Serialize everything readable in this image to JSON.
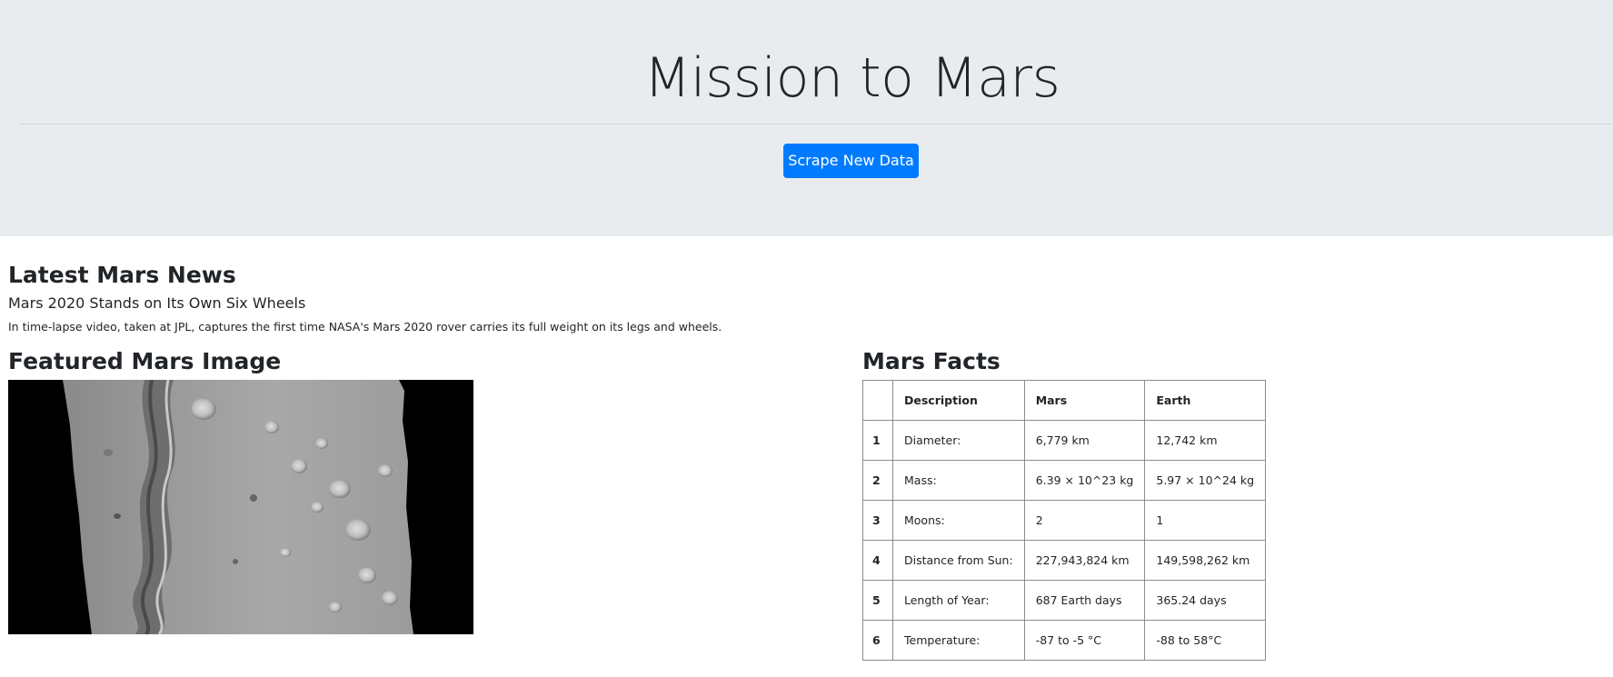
{
  "jumbotron": {
    "title": "Mission to Mars",
    "button_label": "Scrape New Data",
    "button_color": "#007bff",
    "background_color": "#e9ecef"
  },
  "news": {
    "heading": "Latest Mars News",
    "title": "Mars 2020 Stands on Its Own Six Wheels",
    "teaser": "In time-lapse video, taken at JPL, captures the first time NASA's Mars 2020 rover carries its full weight on its legs and wheels."
  },
  "featured_image": {
    "heading": "Featured Mars Image",
    "image_kind": "grayscale-mars-terrain-photo"
  },
  "facts": {
    "heading": "Mars Facts",
    "columns": [
      "",
      "Description",
      "Mars",
      "Earth"
    ],
    "rows": [
      {
        "index": "1",
        "description": "Diameter:",
        "mars": "6,779 km",
        "earth": "12,742 km"
      },
      {
        "index": "2",
        "description": "Mass:",
        "mars": "6.39 × 10^23 kg",
        "earth": "5.97 × 10^24 kg"
      },
      {
        "index": "3",
        "description": "Moons:",
        "mars": "2",
        "earth": "1"
      },
      {
        "index": "4",
        "description": "Distance from Sun:",
        "mars": "227,943,824 km",
        "earth": "149,598,262 km"
      },
      {
        "index": "5",
        "description": "Length of Year:",
        "mars": "687 Earth days",
        "earth": "365.24 days"
      },
      {
        "index": "6",
        "description": "Temperature:",
        "mars": "-87 to -5 °C",
        "earth": "-88 to 58°C"
      }
    ]
  }
}
